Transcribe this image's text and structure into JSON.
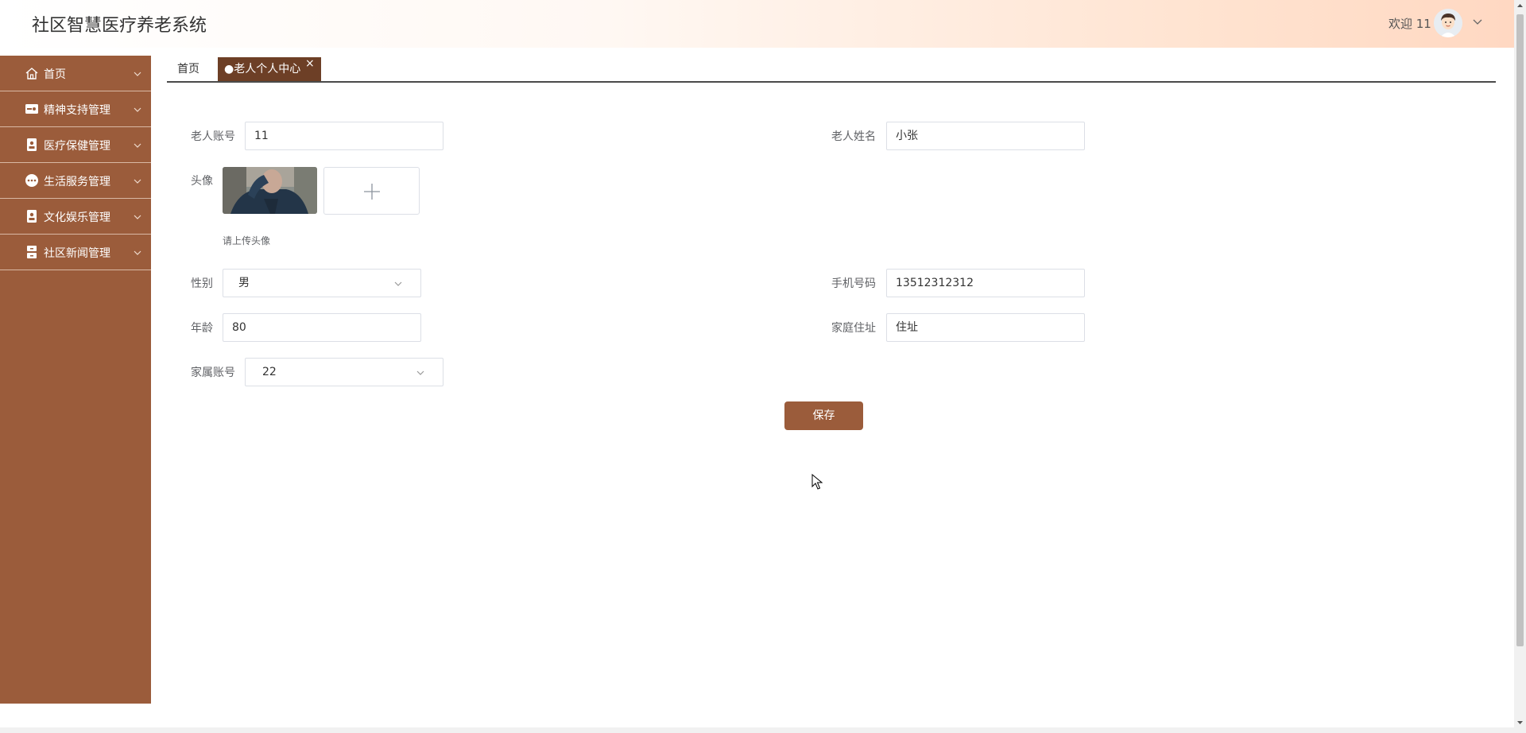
{
  "header": {
    "app_title": "社区智慧医疗养老系统",
    "welcome_text": "欢迎 11"
  },
  "sidebar": {
    "items": [
      {
        "label": "首页",
        "icon": "home-icon"
      },
      {
        "label": "精神支持管理",
        "icon": "support-icon"
      },
      {
        "label": "医疗保健管理",
        "icon": "medical-icon"
      },
      {
        "label": "生活服务管理",
        "icon": "chat-icon"
      },
      {
        "label": "文化娱乐管理",
        "icon": "culture-icon"
      },
      {
        "label": "社区新闻管理",
        "icon": "news-icon"
      }
    ]
  },
  "tabs": {
    "home_label": "首页",
    "active_label": "●老人个人中心",
    "close_glyph": "×"
  },
  "form": {
    "account_label": "老人账号",
    "account_value": "11",
    "name_label": "老人姓名",
    "name_value": "小张",
    "avatar_label": "头像",
    "upload_hint": "请上传头像",
    "gender_label": "性别",
    "gender_value": "男",
    "phone_label": "手机号码",
    "phone_value": "13512312312",
    "age_label": "年龄",
    "age_value": "80",
    "address_label": "家庭住址",
    "address_value": "住址",
    "family_label": "家属账号",
    "family_value": "22",
    "save_label": "保存"
  },
  "colors": {
    "sidebar_bg": "#9b5c3b",
    "active_tab_bg": "#6d3f26",
    "save_button_bg": "#9b5c3b"
  }
}
